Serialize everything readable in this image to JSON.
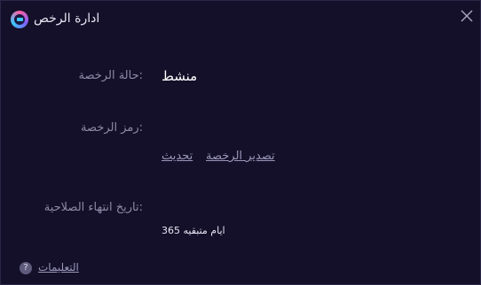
{
  "window": {
    "title": "ادارة الرخص",
    "logo_icon": "app-logo-icon",
    "close_icon": "close-icon"
  },
  "license": {
    "status_label": ":حالة الرخصة",
    "status_value": "منشط",
    "code_label": ":رمز الرخصة",
    "refresh_link": "تحديث",
    "export_link": "تصدير الرخصة",
    "expiry_label": ":تاريخ انتهاء الصلاحية",
    "expiry_value": "ايام متبقيه 365"
  },
  "footer": {
    "help_icon_glyph": "?",
    "help_link": "التعليمات"
  },
  "colors": {
    "background": "#14102a",
    "label": "#8d8aa6",
    "value": "#ffffff",
    "link": "#9a97b8"
  }
}
